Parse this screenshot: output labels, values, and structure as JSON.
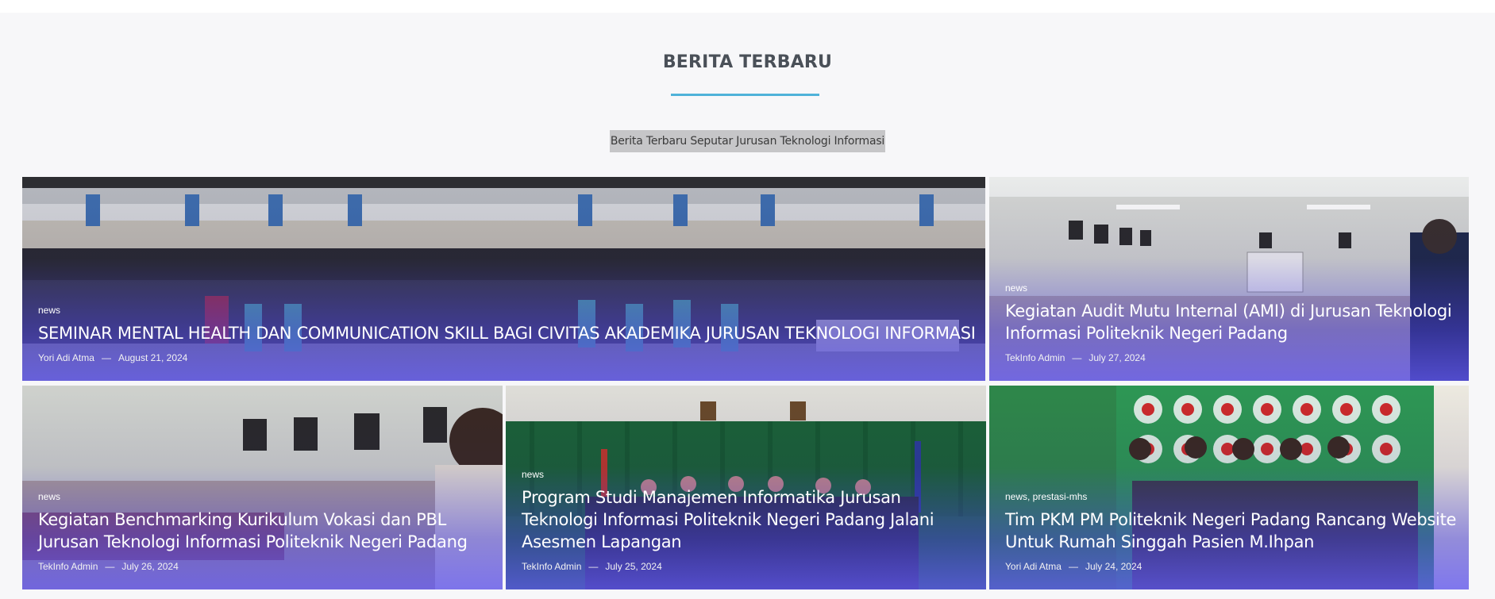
{
  "section": {
    "heading": "BERITA TERBARU",
    "subtitle": "Berita Terbaru Seputar Jurusan Teknologi Informasi"
  },
  "posts": [
    {
      "category": "news",
      "title": "SEMINAR MENTAL HEALTH DAN COMMUNICATION SKILL BAGI CIVITAS AKADEMIKA JURUSAN TEKNOLOGI INFORMASI",
      "author": "Yori Adi Atma",
      "date": "August 21, 2024",
      "separator": "—"
    },
    {
      "category": "news",
      "title": "Kegiatan Audit Mutu Internal (AMI) di Jurusan Teknologi Informasi Politeknik Negeri Padang",
      "author": "TekInfo Admin",
      "date": "July 27, 2024",
      "separator": "—"
    },
    {
      "category": "news",
      "title": "Kegiatan Benchmarking Kurikulum Vokasi dan PBL Jurusan Teknologi Informasi Politeknik Negeri Padang",
      "author": "TekInfo Admin",
      "date": "July 26, 2024",
      "separator": "—"
    },
    {
      "category": "news",
      "title": "Program Studi Manajemen Informatika Jurusan Teknologi Informasi Politeknik Negeri Padang Jalani Asesmen Lapangan",
      "author": "TekInfo Admin",
      "date": "July 25, 2024",
      "separator": "—"
    },
    {
      "category": "news, prestasi-mhs",
      "title": "Tim PKM PM Politeknik Negeri Padang Rancang Website Untuk Rumah Singgah Pasien M.Ihpan",
      "author": "Yori Adi Atma",
      "date": "July 24, 2024",
      "separator": "—"
    }
  ]
}
